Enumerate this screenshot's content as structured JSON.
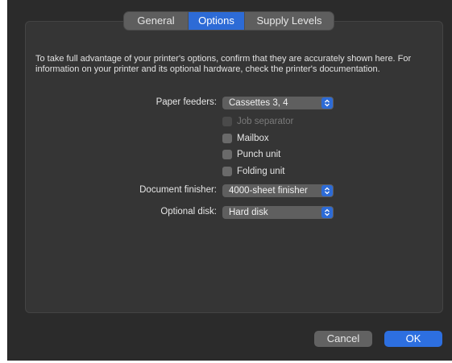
{
  "tabs": [
    {
      "label": "General",
      "active": false
    },
    {
      "label": "Options",
      "active": true
    },
    {
      "label": "Supply Levels",
      "active": false
    }
  ],
  "intro_text": "To take full advantage of your printer's options, confirm that they are accurately shown here. For information on your printer and its optional hardware, check the printer's documentation.",
  "paper_feeders": {
    "label": "Paper feeders:",
    "value": "Cassettes 3, 4"
  },
  "checkboxes": [
    {
      "label": "Job separator",
      "checked": false,
      "enabled": false
    },
    {
      "label": "Mailbox",
      "checked": false,
      "enabled": true
    },
    {
      "label": "Punch unit",
      "checked": false,
      "enabled": true
    },
    {
      "label": "Folding unit",
      "checked": false,
      "enabled": true
    }
  ],
  "document_finisher": {
    "label": "Document finisher:",
    "value": "4000-sheet finisher"
  },
  "optional_disk": {
    "label": "Optional disk:",
    "value": "Hard disk"
  },
  "buttons": {
    "cancel": "Cancel",
    "ok": "OK"
  },
  "colors": {
    "accent": "#2d6bd6",
    "background": "#2b2b2b",
    "panel": "#353535"
  }
}
